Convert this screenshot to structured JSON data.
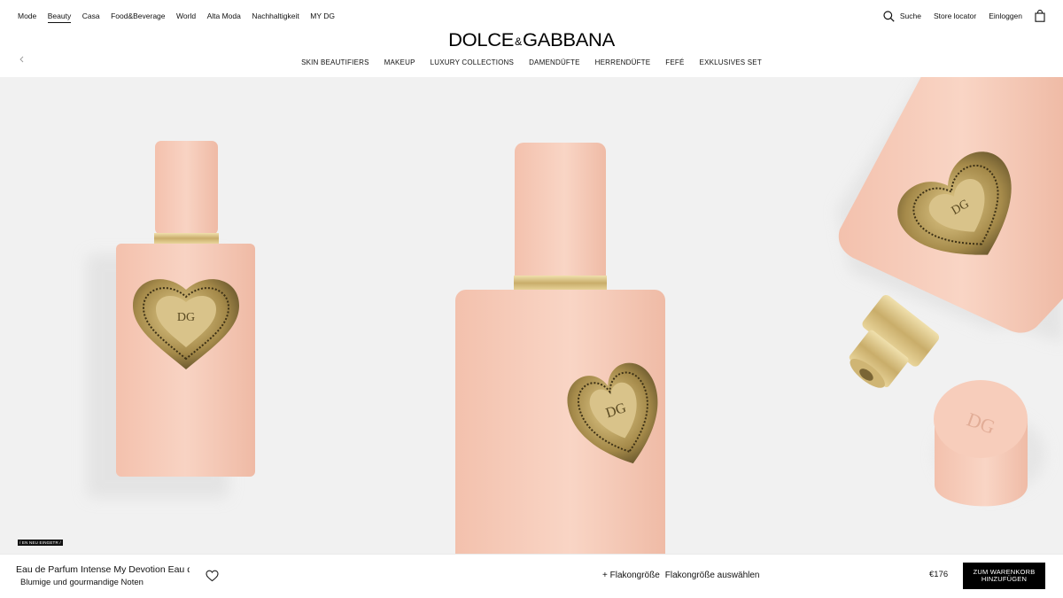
{
  "topnav": {
    "items": [
      {
        "label": "Mode"
      },
      {
        "label": "Beauty",
        "active": true
      },
      {
        "label": "Casa"
      },
      {
        "label": "Food&Beverage"
      },
      {
        "label": "World"
      },
      {
        "label": "Alta Moda"
      },
      {
        "label": "Nachhaltigkeit"
      },
      {
        "label": "MY DG"
      }
    ]
  },
  "utility": {
    "search_label": "Suche",
    "store_label": "Store locator",
    "login_label": "Einloggen",
    "search_icon": "search-icon",
    "bag_icon": "shopping-bag-icon"
  },
  "brand": {
    "left": "DOLCE",
    "amp": "&",
    "right": "GABBANA"
  },
  "catnav": {
    "items": [
      {
        "label": "SKIN BEAUTIFIERS"
      },
      {
        "label": "MAKEUP"
      },
      {
        "label": "LUXURY COLLECTIONS"
      },
      {
        "label": "DAMENDÜFTE"
      },
      {
        "label": "HERRENDÜFTE"
      },
      {
        "label": "FEFÉ"
      },
      {
        "label": "EXKLUSIVES SET"
      }
    ]
  },
  "hero": {
    "badge": "/ EN   NEU EINGETR /",
    "colors": {
      "background": "#f1f1f1",
      "bottle": "#f6c9b6",
      "gold": "#d7bf83"
    }
  },
  "product": {
    "name": "Eau de Parfum Intense  My Devotion Eau de",
    "description": "Blumige und gourmandige Noten",
    "size_toggle": "+ Flakongröße",
    "size_select": "Flakongröße auswählen",
    "price": "€176",
    "cart_button": "ZUM WARENKORB HINZUFÜGEN"
  },
  "colors": {
    "accent": "#000000",
    "text": "#111111"
  }
}
